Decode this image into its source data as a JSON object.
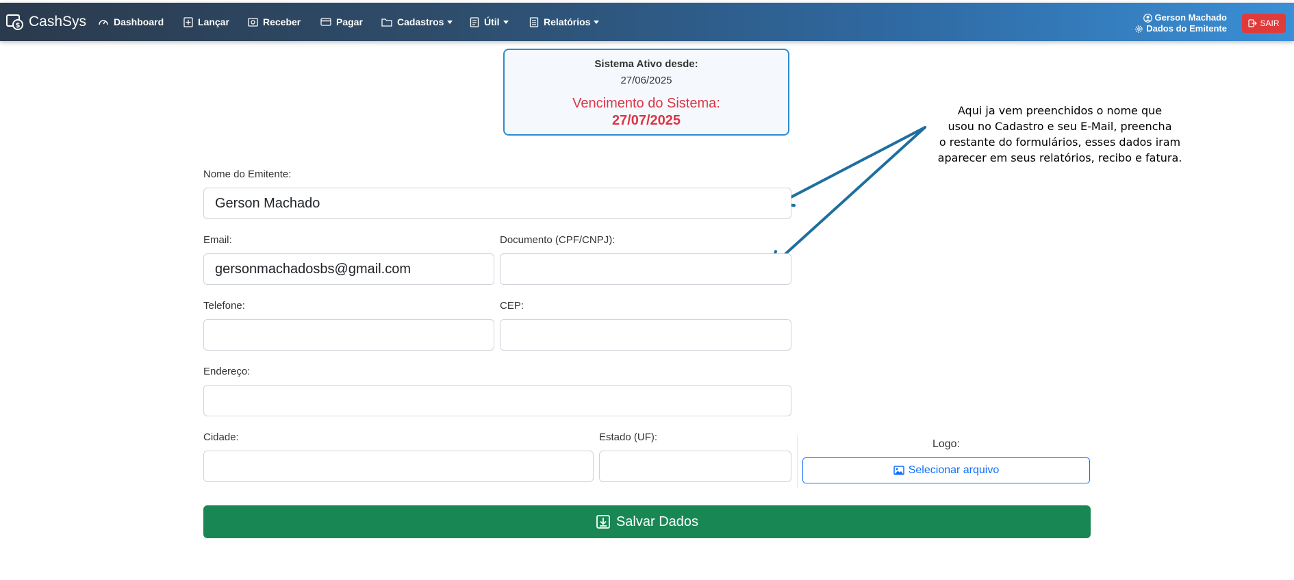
{
  "app": {
    "brand": "CashSys",
    "colors": {
      "nav_start": "#2b3a4d",
      "nav_end": "#3a8fd6",
      "danger": "#dc3545",
      "success": "#198754",
      "primary": "#0d6efd"
    }
  },
  "nav": {
    "items": [
      {
        "label": "Dashboard",
        "icon": "speedometer-icon"
      },
      {
        "label": "Lançar",
        "icon": "plus-square-icon"
      },
      {
        "label": "Receber",
        "icon": "receive-icon"
      },
      {
        "label": "Pagar",
        "icon": "credit-card-icon"
      },
      {
        "label": "Cadastros",
        "icon": "folder-icon",
        "dropdown": true
      },
      {
        "label": "Útil",
        "icon": "document-icon",
        "dropdown": true
      },
      {
        "label": "Relatórios",
        "icon": "report-icon",
        "dropdown": true
      }
    ],
    "user_name": "Gerson Machado",
    "user_settings": "Dados do Emitente",
    "logout_label": "SAIR"
  },
  "status": {
    "active_label": "Sistema Ativo desde:",
    "active_date": "27/06/2025",
    "due_label": "Vencimento do Sistema:",
    "due_date": "27/07/2025"
  },
  "annotation": {
    "lines": [
      "Aqui ja vem preenchidos o nome que",
      "usou no Cadastro e seu E-Mail, preencha",
      "o restante do formulários, esses dados iram",
      "aparecer em seus relatórios, recibo e fatura."
    ]
  },
  "form": {
    "nome_label": "Nome do Emitente:",
    "nome_value": "Gerson Machado",
    "email_label": "Email:",
    "email_value": "gersonmachadosbs@gmail.com",
    "documento_label": "Documento (CPF/CNPJ):",
    "documento_value": "",
    "telefone_label": "Telefone:",
    "telefone_value": "",
    "cep_label": "CEP:",
    "cep_value": "",
    "endereco_label": "Endereço:",
    "endereco_value": "",
    "cidade_label": "Cidade:",
    "cidade_value": "",
    "estado_label": "Estado (UF):",
    "estado_value": "",
    "logo_label": "Logo:",
    "file_button": "Selecionar arquivo",
    "save_button": "Salvar Dados"
  }
}
